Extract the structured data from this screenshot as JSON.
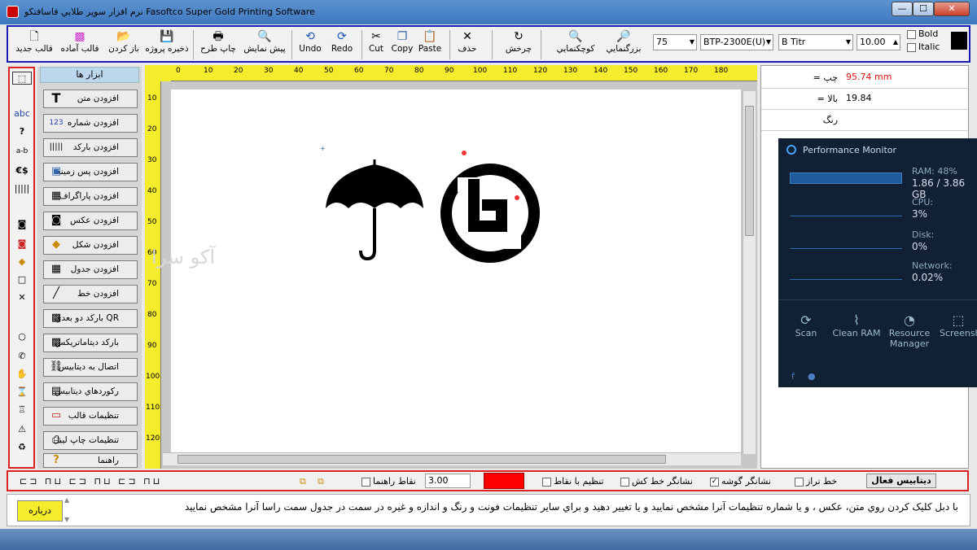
{
  "window": {
    "title": "Fasoftco Super Gold Printing Software",
    "title_fa": "نرم افزار سوپر طلايي فاسافتکو",
    "min": "—",
    "max": "☐",
    "close": "✕"
  },
  "toolbar": {
    "new_template": "قالب جديد",
    "ready_template": "قالب آماده",
    "open": "باز کردن",
    "save_project": "ذخيره پروژه",
    "print_design": "چاپ طرح",
    "preview": "پيش نمايش",
    "undo": "Undo",
    "redo": "Redo",
    "cut": "Cut",
    "copy": "Copy",
    "paste": "Paste",
    "delete": "حذف",
    "rotate": "چرخش",
    "zoom_out": "کوچکنمايي",
    "zoom_in": "بزرگنمايي",
    "zoom_value": "75",
    "printer": "BTP-2300E(U)",
    "font": "B Titr",
    "font_size": "10.00",
    "bold": "Bold",
    "italic": "Italic"
  },
  "left_tools": [
    "abc",
    "?",
    "a-b",
    "€$"
  ],
  "tool_panel": {
    "header": "ابزار ها",
    "buttons": [
      {
        "label": "افزودن متن",
        "icon": "T"
      },
      {
        "label": "افزودن شماره",
        "icon": "123"
      },
      {
        "label": "افزودن بارکد",
        "icon": "|||||"
      },
      {
        "label": "افزودن پس زمينه",
        "icon": "▣"
      },
      {
        "label": "افزودن پاراگراف",
        "icon": "▦"
      },
      {
        "label": "افزودن عکس",
        "icon": "◙"
      },
      {
        "label": "افزودن شکل",
        "icon": "◆"
      },
      {
        "label": "افزودن جدول",
        "icon": "▦"
      },
      {
        "label": "افزودن خط",
        "icon": "╱"
      },
      {
        "label": "بارکد دو بعدي QR",
        "icon": "▩"
      },
      {
        "label": "بارکد ديتاماتريکس",
        "icon": "▩"
      },
      {
        "label": "اتصال به ديتابيس",
        "icon": "⛓"
      },
      {
        "label": "رکوردهاي ديتابيس",
        "icon": "▤"
      },
      {
        "label": "تنظيمات قالب",
        "icon": "▭"
      },
      {
        "label": "تنظيمات چاپ ليبل",
        "icon": "⎙"
      },
      {
        "label": "راهنما",
        "icon": "?"
      }
    ]
  },
  "rulers": {
    "top": [
      "0",
      "10",
      "20",
      "30",
      "40",
      "50",
      "60",
      "70",
      "80",
      "90",
      "100",
      "110",
      "120",
      "130",
      "140",
      "150",
      "160",
      "170",
      "180"
    ],
    "left": [
      "10",
      "20",
      "30",
      "40",
      "50",
      "60",
      "70",
      "80",
      "90",
      "100",
      "110",
      "120"
    ]
  },
  "canvas": {
    "watermark": "آکو سرا"
  },
  "properties": {
    "left_label": "= چپ",
    "left_value": "95.74 mm",
    "top_label": "= بالا",
    "top_value": "19.84",
    "color_label": "رنگ"
  },
  "perf_monitor": {
    "title": "Performance Monitor",
    "ram_label": "RAM: 48%",
    "ram_value": "1.86 / 3.86 GB",
    "cpu_label": "CPU:",
    "cpu_value": "3%",
    "disk_label": "Disk:",
    "disk_value": "0%",
    "net_label": "Network:",
    "net_value": "0.02%",
    "actions": [
      "Scan",
      "Clean RAM",
      "Resource Manager",
      "Screensh"
    ]
  },
  "bottom_bar": {
    "guide_points": "نقاط راهنما",
    "spacing": "3.00",
    "align_points": "تنظيم با نقاط",
    "drag_line": "نشانگر خط کش",
    "corner_marker": "نشانگر گوشه",
    "level_line": "خط تراز",
    "active_db": "ديتابيس فعال"
  },
  "status": {
    "about": "درباره",
    "message": "با دبل کليک کردن روي متن، عکس ، و يا شماره تنظيمات آنرا مشخص نماييد و يا تغيير دهيد و براي ساير تنظيمات فونت و رنگ و اندازه و غيره در سمت در جدول سمت راسا آنرا مشخص نماييد"
  }
}
